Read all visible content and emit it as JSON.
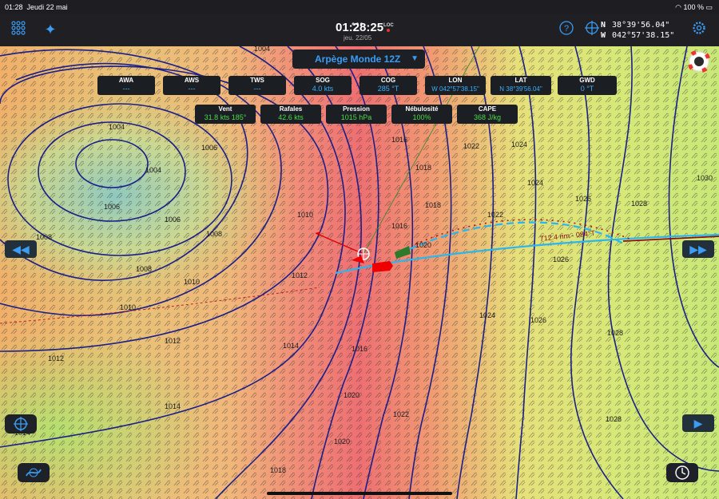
{
  "status_bar": {
    "time": "01:28",
    "date": "Jeudi 22 mai",
    "battery": "100 %"
  },
  "topbar": {
    "clock": "01:28:25",
    "clock_suffix": "LOC",
    "date": "jeu. 22/05",
    "lat_hemi": "N",
    "lat": "38°39'56.04\"",
    "lon_hemi": "W",
    "lon": "042°57'38.15\""
  },
  "model_selector": {
    "label": "Arpège Monde 12Z"
  },
  "tiles_row1": [
    {
      "key": "AWA",
      "value": "---"
    },
    {
      "key": "AWS",
      "value": "---"
    },
    {
      "key": "TWS",
      "value": "---"
    },
    {
      "key": "SOG",
      "value": "4.0 kts"
    },
    {
      "key": "COG",
      "value": "285 °T"
    },
    {
      "key": "LON",
      "value": "W 042°57'38.15\""
    },
    {
      "key": "LAT",
      "value": "N  38°39'56.04\""
    },
    {
      "key": "GWD",
      "value": "0 °T"
    }
  ],
  "tiles_row2": [
    {
      "key": "Vent",
      "value": "31.8 kts 185°"
    },
    {
      "key": "Rafales",
      "value": "42.6 kts"
    },
    {
      "key": "Pression",
      "value": "1015 hPa"
    },
    {
      "key": "Nébulosité",
      "value": "100%"
    },
    {
      "key": "CAPE",
      "value": "368 J/kg"
    }
  ],
  "route_label": "712.4 nm - 084°T",
  "isobar_labels": [
    {
      "text": "1004"
    },
    {
      "text": "1004"
    },
    {
      "text": "1004"
    },
    {
      "text": "1006"
    },
    {
      "text": "1006"
    },
    {
      "text": "1006"
    },
    {
      "text": "1008"
    },
    {
      "text": "1008"
    },
    {
      "text": "1008"
    },
    {
      "text": "1010"
    },
    {
      "text": "1010"
    },
    {
      "text": "1010"
    },
    {
      "text": "1012"
    },
    {
      "text": "1012"
    },
    {
      "text": "1012"
    },
    {
      "text": "1014"
    },
    {
      "text": "1014"
    },
    {
      "text": "1014"
    },
    {
      "text": "1016"
    },
    {
      "text": "1016"
    },
    {
      "text": "1016"
    },
    {
      "text": "1018"
    },
    {
      "text": "1018"
    },
    {
      "text": "1018"
    },
    {
      "text": "1020"
    },
    {
      "text": "1020"
    },
    {
      "text": "1020"
    },
    {
      "text": "1022"
    },
    {
      "text": "1022"
    },
    {
      "text": "1022"
    },
    {
      "text": "1024"
    },
    {
      "text": "1024"
    },
    {
      "text": "1024"
    },
    {
      "text": "1026"
    },
    {
      "text": "1026"
    },
    {
      "text": "1026"
    },
    {
      "text": "1028"
    },
    {
      "text": "1028"
    },
    {
      "text": "1028"
    },
    {
      "text": "1030"
    }
  ],
  "colors": {
    "accent": "#3b9cf2",
    "tile_value": "#4cd94c",
    "isobar": "#1a1f8a",
    "route": "#2ab7f0",
    "route_alt": "#b01818"
  },
  "icons": {
    "grid": "apps-grid-icon",
    "satellite": "satellite-icon",
    "help": "help-icon",
    "position": "crosshair-icon",
    "settings": "gear-icon",
    "rescue": "lifebuoy-icon",
    "rewind": "rewind-icon",
    "forward": "fast-forward-icon",
    "play": "play-icon",
    "center": "crosshair-icon",
    "route": "route-icon",
    "clock": "clock-icon"
  }
}
